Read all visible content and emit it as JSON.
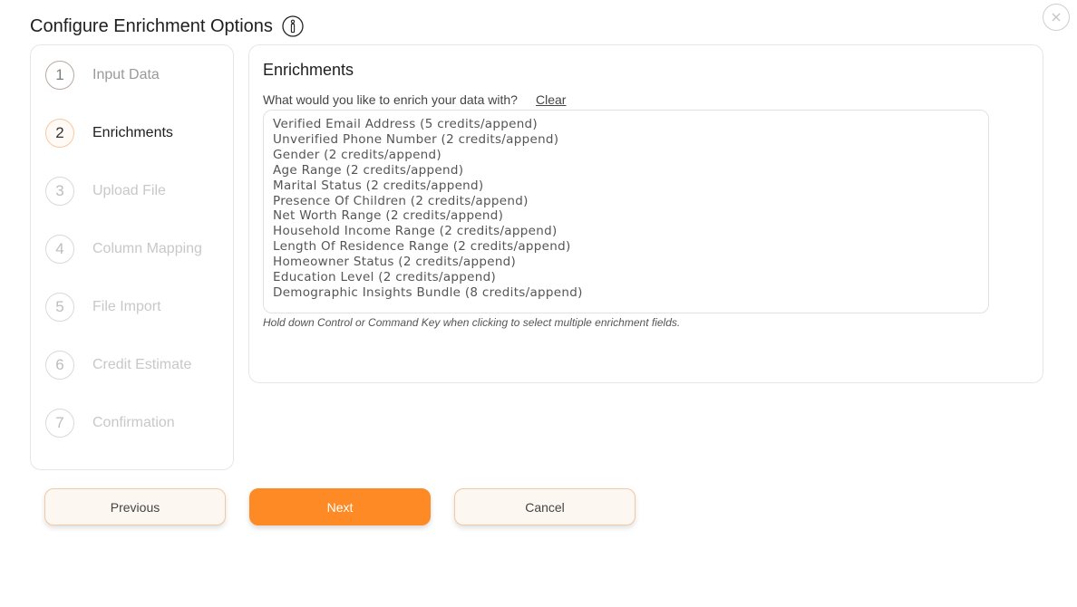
{
  "header": {
    "title": "Configure Enrichment Options"
  },
  "steps": [
    {
      "number": "1",
      "label": "Input Data"
    },
    {
      "number": "2",
      "label": "Enrichments"
    },
    {
      "number": "3",
      "label": "Upload File"
    },
    {
      "number": "4",
      "label": "Column Mapping"
    },
    {
      "number": "5",
      "label": "File Import"
    },
    {
      "number": "6",
      "label": "Credit Estimate"
    },
    {
      "number": "7",
      "label": "Confirmation"
    }
  ],
  "enrichments": {
    "title": "Enrichments",
    "question": "What would you like to enrich your data with?",
    "clear_label": "Clear",
    "options": [
      "Verified Email Address (5 credits/append)",
      "Unverified Phone Number (2 credits/append)",
      "Gender (2 credits/append)",
      "Age Range (2 credits/append)",
      "Marital Status (2 credits/append)",
      "Presence Of Children (2 credits/append)",
      "Net Worth Range (2 credits/append)",
      "Household Income Range (2 credits/append)",
      "Length Of Residence Range (2 credits/append)",
      "Homeowner Status (2 credits/append)",
      "Education Level (2 credits/append)",
      "Demographic Insights Bundle (8 credits/append)"
    ],
    "hint": "Hold down Control or Command Key when clicking to select multiple enrichment fields."
  },
  "footer": {
    "previous_label": "Previous",
    "next_label": "Next",
    "cancel_label": "Cancel"
  },
  "colors": {
    "accent": "#fd8a24",
    "secondary_button_bg": "#fdf7f2"
  },
  "icons": {
    "info": "info-icon",
    "close": "close-icon"
  }
}
